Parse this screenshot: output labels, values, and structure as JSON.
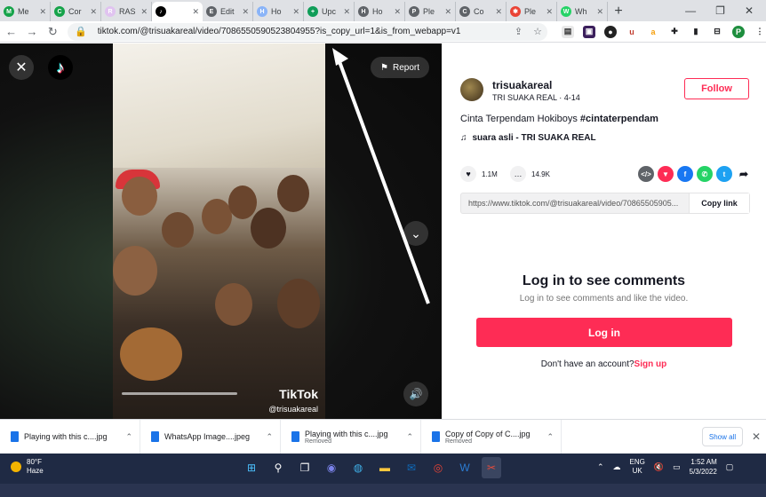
{
  "tabs": [
    {
      "label": "Me",
      "color": "#16a34a",
      "glyph": "M"
    },
    {
      "label": "Cor",
      "color": "#16a34a",
      "glyph": "C"
    },
    {
      "label": "RAS",
      "color": "#e0c3f0",
      "glyph": "R"
    },
    {
      "label": "",
      "color": "#000000",
      "glyph": "♪",
      "active": true
    },
    {
      "label": "Edit",
      "color": "#5f6368",
      "glyph": "E"
    },
    {
      "label": "Ho",
      "color": "#8ab4f8",
      "glyph": "H"
    },
    {
      "label": "Upc",
      "color": "#0f9d58",
      "glyph": "+"
    },
    {
      "label": "Ho",
      "color": "#5f6368",
      "glyph": "H"
    },
    {
      "label": "Ple",
      "color": "#5f6368",
      "glyph": "P"
    },
    {
      "label": "Co",
      "color": "#5f6368",
      "glyph": "C"
    },
    {
      "label": "Ple",
      "color": "#ea4335",
      "glyph": "✱"
    },
    {
      "label": "Wh",
      "color": "#25d366",
      "glyph": "W"
    }
  ],
  "browser": {
    "url": "tiktok.com/@trisuakareal/video/7086550590523804955?is_copy_url=1&is_from_webapp=v1",
    "new_tab": "+",
    "win_min": "—",
    "win_restore": "❐",
    "win_close": "✕",
    "profile": "P"
  },
  "video": {
    "close": "✕",
    "logo": "♪",
    "report_label": "Report",
    "report_icon": "⚑",
    "down": "⌄",
    "volume": "🔊",
    "watermark": "TikTok",
    "watermark_user": "@trisuakareal"
  },
  "panel": {
    "author": "trisuakareal",
    "author_sub": "TRI SUAKA REAL · 4-14",
    "follow_label": "Follow",
    "desc_text": "Cinta Terpendam Hokiboys ",
    "desc_tag": "#cintaterpendam",
    "music_icon": "♫",
    "music": "suara asli - TRI SUAKA REAL",
    "likes": "1.1M",
    "comments": "14.9K",
    "share_link": "https://www.tiktok.com/@trisuakareal/video/70865505905...",
    "copy_label": "Copy link",
    "login_title": "Log in to see comments",
    "login_sub": "Log in to see comments and like the video.",
    "login_button": "Log in",
    "signup_prompt": "Don't have an account?",
    "signup_link": "Sign up"
  },
  "downloads": [
    {
      "name": "Playing with this c....jpg",
      "status": ""
    },
    {
      "name": "WhatsApp Image....jpeg",
      "status": ""
    },
    {
      "name": "Playing with this c....jpg",
      "status": "Removed"
    },
    {
      "name": "Copy of Copy of C....jpg",
      "status": "Removed"
    }
  ],
  "downloads_bar": {
    "show_all": "Show all",
    "close": "✕"
  },
  "taskbar": {
    "temp": "80°F",
    "weather": "Haze",
    "lang1": "ENG",
    "lang2": "UK",
    "time": "1:52 AM",
    "date": "5/3/2022"
  }
}
